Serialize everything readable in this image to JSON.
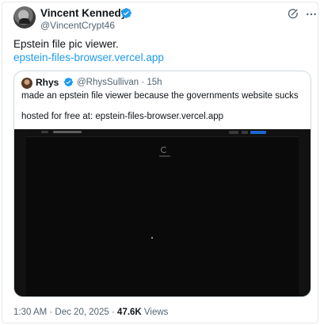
{
  "author": {
    "name": "Vincent Kennedy",
    "handle": "@VincentCrypt46"
  },
  "tweet": {
    "text": "Epstein file pic viewer.",
    "link": "epstein-files-browser.vercel.app"
  },
  "quote": {
    "name": "Rhys",
    "handle_time": "@RhysSullivan · 15h",
    "line1": "made an epstein file viewer because the governments website sucks",
    "line2": "hosted for free at: epstein-files-browser.vercel.app"
  },
  "meta": {
    "timestamp": "1:30 AM · Dec 20, 2025 · ",
    "views_count": "47.6K",
    "views_label": " Views"
  },
  "icons": {
    "verified": "verified-badge-icon",
    "grok": "grok-icon",
    "more": "more-icon"
  },
  "colors": {
    "link": "#1d9bf0",
    "secondary_text": "#536471",
    "verified": "#1d9bf0",
    "media_bg": "#0a0a0a"
  }
}
